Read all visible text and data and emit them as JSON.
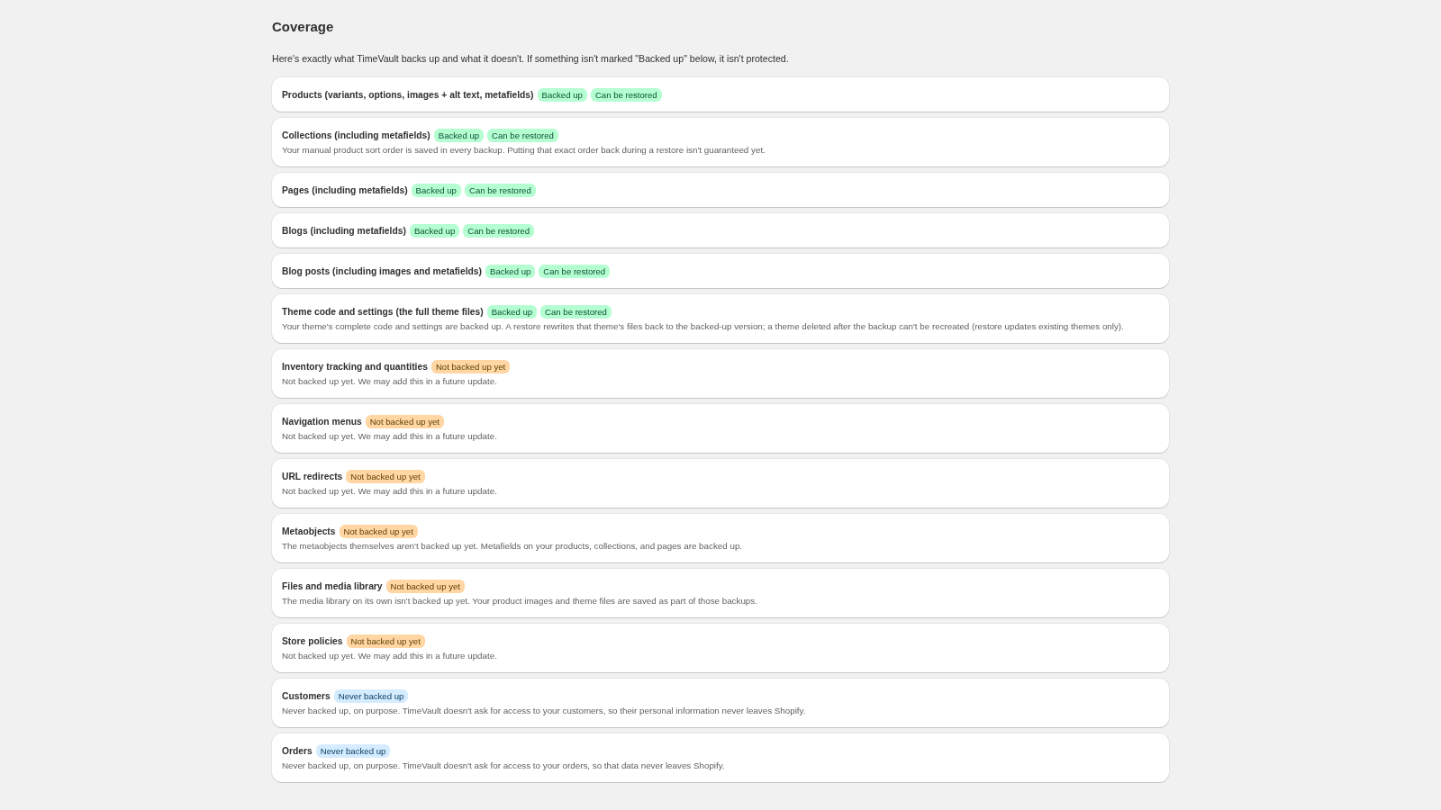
{
  "page": {
    "title": "Coverage",
    "intro": "Here's exactly what TimeVault backs up and what it doesn't. If something isn't marked \"Backed up\" below, it isn't protected."
  },
  "items": [
    {
      "name": "Products (variants, options, images + alt text, metafields)",
      "badges": [
        {
          "label": "Backed up",
          "color": "#b4fed2"
        },
        {
          "label": "Can be restored",
          "color": "#b4fed2"
        }
      ]
    },
    {
      "name": "Collections (including metafields)",
      "badges": [
        {
          "label": "Backed up",
          "color": "#b4fed2"
        },
        {
          "label": "Can be restored",
          "color": "#b4fed2"
        }
      ],
      "description": "Your manual product sort order is saved in every backup. Putting that exact order back during a restore isn't guaranteed yet."
    },
    {
      "name": "Pages (including metafields)",
      "badges": [
        {
          "label": "Backed up",
          "color": "#b4fed2"
        },
        {
          "label": "Can be restored",
          "color": "#b4fed2"
        }
      ]
    },
    {
      "name": "Blogs (including metafields)",
      "badges": [
        {
          "label": "Backed up",
          "color": "#b4fed2"
        },
        {
          "label": "Can be restored",
          "color": "#b4fed2"
        }
      ]
    },
    {
      "name": "Blog posts (including images and metafields)",
      "badges": [
        {
          "label": "Backed up",
          "color": "#b4fed2"
        },
        {
          "label": "Can be restored",
          "color": "#b4fed2"
        }
      ]
    },
    {
      "name": "Theme code and settings (the full theme files)",
      "badges": [
        {
          "label": "Backed up",
          "color": "#b4fed2"
        },
        {
          "label": "Can be restored",
          "color": "#b4fed2"
        }
      ],
      "description": "Your theme's complete code and settings are backed up. A restore rewrites that theme's files back to the backed-up version; a theme deleted after the backup can't be recreated (restore updates existing themes only)."
    },
    {
      "name": "Inventory tracking and quantities",
      "badges": [
        {
          "label": "Not backed up yet",
          "color": "#ffd6a4"
        }
      ],
      "description": "Not backed up yet. We may add this in a future update."
    },
    {
      "name": "Navigation menus",
      "badges": [
        {
          "label": "Not backed up yet",
          "color": "#ffd6a4"
        }
      ],
      "description": "Not backed up yet. We may add this in a future update."
    },
    {
      "name": "URL redirects",
      "badges": [
        {
          "label": "Not backed up yet",
          "color": "#ffd6a4"
        }
      ],
      "description": "Not backed up yet. We may add this in a future update."
    },
    {
      "name": "Metaobjects",
      "badges": [
        {
          "label": "Not backed up yet",
          "color": "#ffd6a4"
        }
      ],
      "description": "The metaobjects themselves aren't backed up yet. Metafields on your products, collections, and pages are backed up."
    },
    {
      "name": "Files and media library",
      "badges": [
        {
          "label": "Not backed up yet",
          "color": "#ffd6a4"
        }
      ],
      "description": "The media library on its own isn't backed up yet. Your product images and theme files are saved as part of those backups."
    },
    {
      "name": "Store policies",
      "badges": [
        {
          "label": "Not backed up yet",
          "color": "#ffd6a4"
        }
      ],
      "description": "Not backed up yet. We may add this in a future update."
    },
    {
      "name": "Customers",
      "badges": [
        {
          "label": "Never backed up",
          "color": "#d5ebff"
        }
      ],
      "description": "Never backed up, on purpose. TimeVault doesn't ask for access to your customers, so their personal information never leaves Shopify."
    },
    {
      "name": "Orders",
      "badges": [
        {
          "label": "Never backed up",
          "color": "#d5ebff"
        }
      ],
      "description": "Never backed up, on purpose. TimeVault doesn't ask for access to your orders, so that data never leaves Shopify."
    }
  ]
}
